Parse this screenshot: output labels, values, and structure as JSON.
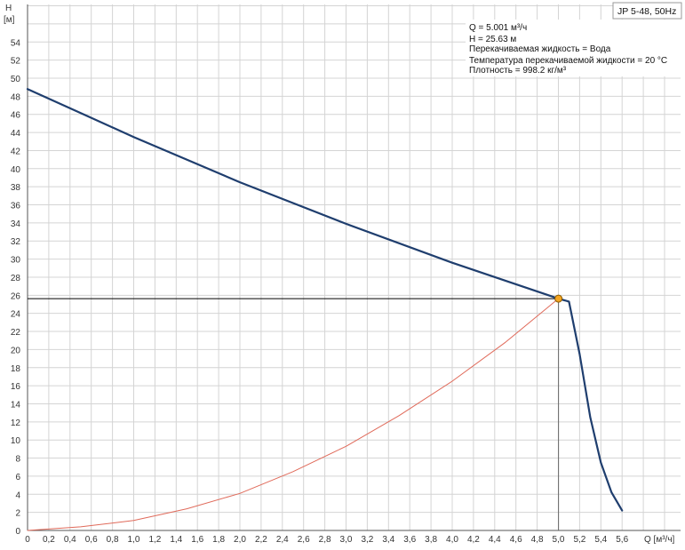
{
  "badge": "JP 5-48, 50Hz",
  "info": {
    "flow": "Q = 5.001 м³/ч",
    "head": "H = 25.63 м",
    "liquid": "Перекачиваемая жидкость = Вода",
    "temperature": "Температура перекачиваемой жидкости = 20 °C",
    "density": "Плотность = 998.2 кг/м³"
  },
  "colors": {
    "pump_curve": "#1f3e6e",
    "system_curve": "#e06a5a",
    "duty_point": "#f5a623",
    "grid": "#d4d4d4",
    "guide_line": "#000000"
  },
  "chart_data": {
    "type": "line",
    "xlabel": "Q [м³/ч]",
    "ylabel_line1": "H",
    "ylabel_line2": "[м]",
    "xlim": [
      0,
      6.0
    ],
    "ylim": [
      0,
      58
    ],
    "grid": true,
    "x_ticks": [
      "0",
      "0,2",
      "0,4",
      "0,6",
      "0,8",
      "1,0",
      "1,2",
      "1,4",
      "1,6",
      "1,8",
      "2,0",
      "2,2",
      "2,4",
      "2,6",
      "2,8",
      "3,0",
      "3,2",
      "3,4",
      "3,6",
      "3,8",
      "4,0",
      "4,2",
      "4,4",
      "4,6",
      "4,8",
      "5,0",
      "5,2",
      "5,4",
      "5,6"
    ],
    "y_ticks": [
      "0",
      "2",
      "4",
      "6",
      "8",
      "10",
      "12",
      "14",
      "16",
      "18",
      "20",
      "22",
      "24",
      "26",
      "28",
      "30",
      "32",
      "34",
      "36",
      "38",
      "40",
      "42",
      "44",
      "46",
      "48",
      "50",
      "52",
      "54"
    ],
    "series": [
      {
        "key": "pump",
        "x": [
          0,
          1.0,
          2.0,
          3.0,
          4.0,
          5.0,
          5.1,
          5.2,
          5.3,
          5.4,
          5.5,
          5.6
        ],
        "y": [
          48.8,
          43.5,
          38.5,
          33.9,
          29.6,
          25.63,
          25.3,
          19.5,
          12.5,
          7.5,
          4.2,
          2.2
        ]
      },
      {
        "key": "system",
        "x": [
          0,
          0.5,
          1.0,
          1.5,
          2.0,
          2.5,
          3.0,
          3.5,
          4.0,
          4.5,
          5.0
        ],
        "y": [
          0,
          0.4,
          1.1,
          2.4,
          4.1,
          6.5,
          9.3,
          12.7,
          16.5,
          20.8,
          25.63
        ]
      }
    ],
    "duty_point": {
      "x": 5.001,
      "y": 25.63
    }
  }
}
